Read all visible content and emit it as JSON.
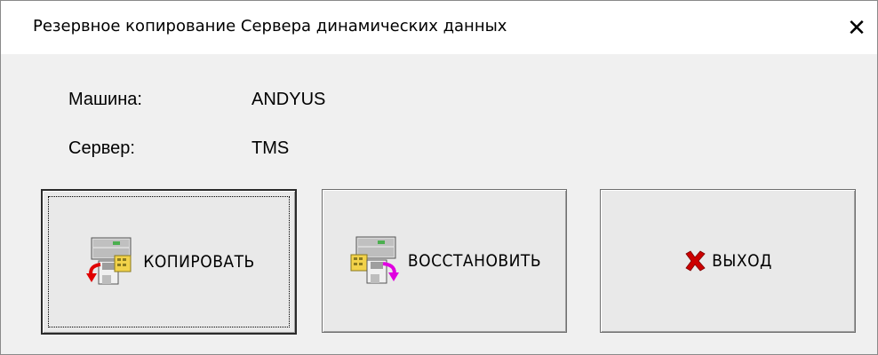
{
  "window": {
    "title": "Резервное копирование Сервера динамических данных",
    "close_glyph": "✕"
  },
  "info": {
    "machine_label": "Машина:",
    "machine_value": "ANDYUS",
    "server_label": "Сервер:",
    "server_value": "TMS"
  },
  "buttons": {
    "copy_label": "КОПИРОВАТЬ",
    "restore_label": "ВОССТАНОВИТЬ",
    "exit_label": "ВЫХОД"
  },
  "icons": {
    "copy": "server-backup-icon",
    "restore": "server-restore-icon",
    "exit": "red-x-icon"
  },
  "colors": {
    "copy_arrow": "#e00000",
    "restore_arrow": "#e000e0",
    "exit_x": "#cc0000"
  }
}
